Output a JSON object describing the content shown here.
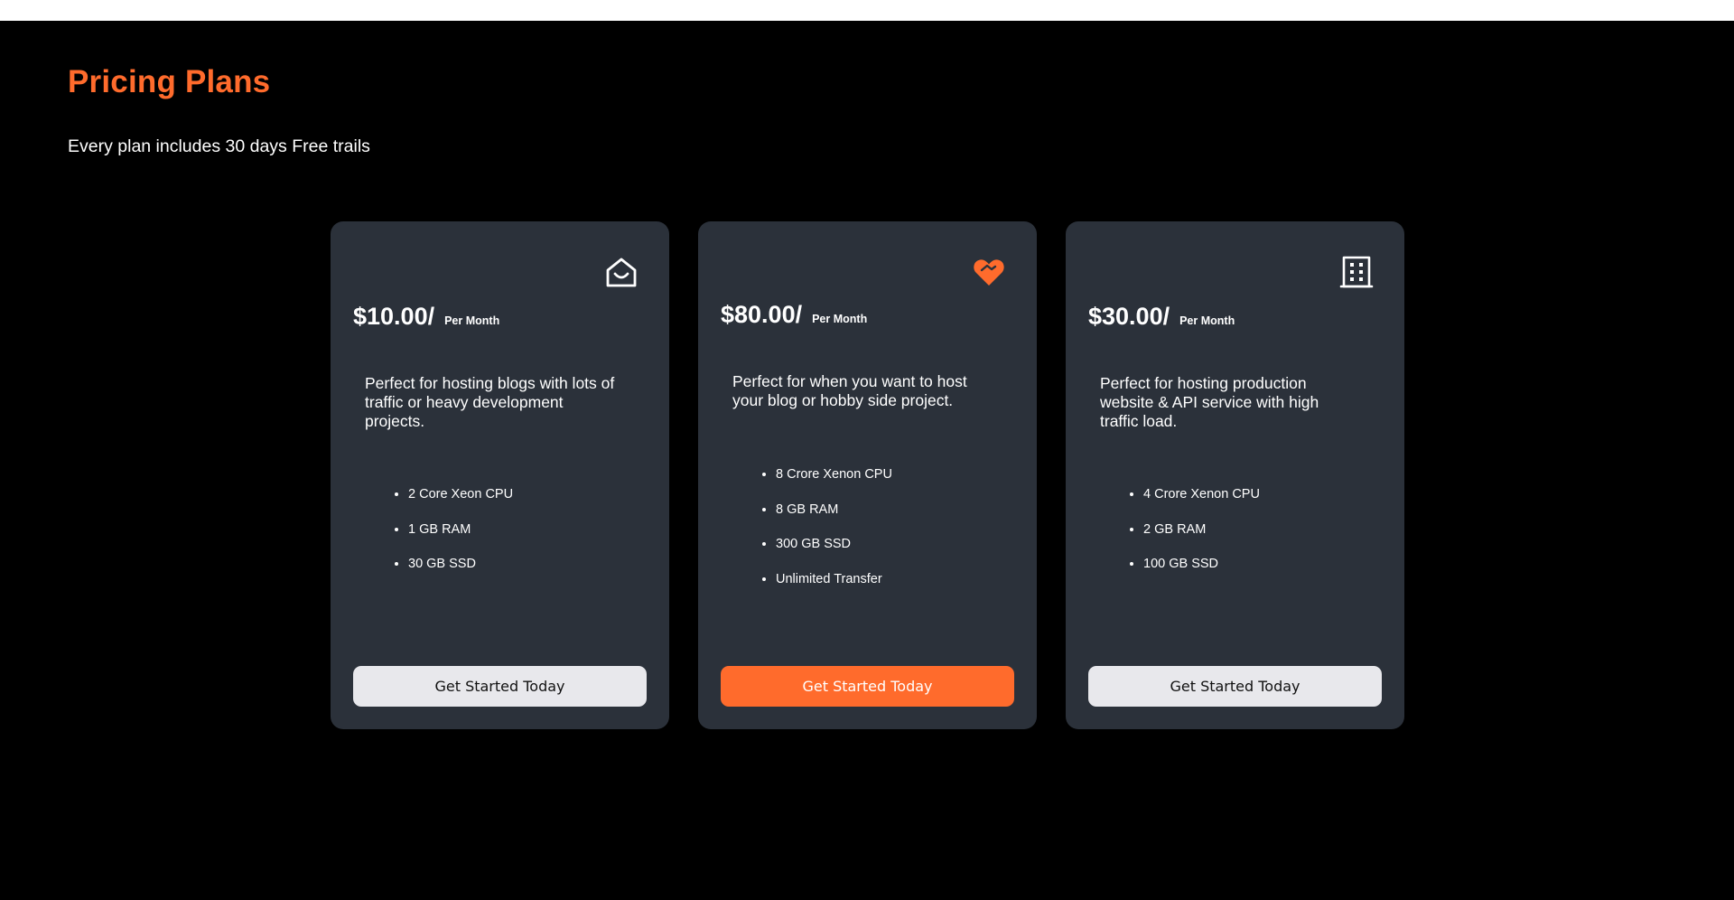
{
  "header": {
    "title": "Pricing Plans",
    "subtitle": "Every plan includes 30 days Free trails"
  },
  "colors": {
    "accent": "#ff6b2c",
    "background": "#000000",
    "card": "#2b313a",
    "button_light": "#e8e8ec"
  },
  "plans": [
    {
      "icon": "home-icon",
      "price": "$10.00/",
      "period": "Per Month",
      "description": "Perfect for hosting blogs with lots of traffic or heavy development projects.",
      "features": [
        "2 Core Xeon CPU",
        "1 GB RAM",
        "30 GB SSD"
      ],
      "button": "Get Started Today"
    },
    {
      "icon": "heart-handshake-icon",
      "price": "$80.00/",
      "period": "Per Month",
      "description": "Perfect for when you want to host your blog or hobby side project.",
      "features": [
        "8 Crore Xenon CPU",
        "8 GB RAM",
        "300 GB SSD",
        "Unlimited Transfer"
      ],
      "button": "Get Started Today"
    },
    {
      "icon": "building-icon",
      "price": "$30.00/",
      "period": "Per Month",
      "description": "Perfect for hosting production website & API service with high traffic load.",
      "features": [
        "4 Crore Xenon CPU",
        "2 GB RAM",
        "100 GB SSD"
      ],
      "button": "Get Started Today"
    }
  ]
}
